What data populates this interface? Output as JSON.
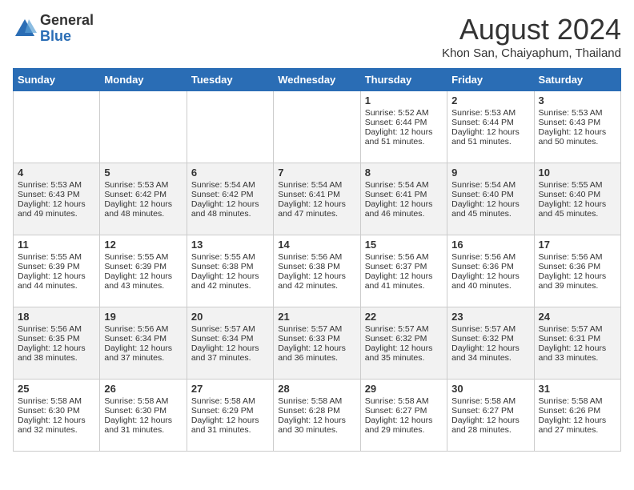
{
  "header": {
    "logo_general": "General",
    "logo_blue": "Blue",
    "month_year": "August 2024",
    "location": "Khon San, Chaiyaphum, Thailand"
  },
  "days_of_week": [
    "Sunday",
    "Monday",
    "Tuesday",
    "Wednesday",
    "Thursday",
    "Friday",
    "Saturday"
  ],
  "weeks": [
    [
      {
        "day": "",
        "content": ""
      },
      {
        "day": "",
        "content": ""
      },
      {
        "day": "",
        "content": ""
      },
      {
        "day": "",
        "content": ""
      },
      {
        "day": "1",
        "content": "Sunrise: 5:52 AM\nSunset: 6:44 PM\nDaylight: 12 hours\nand 51 minutes."
      },
      {
        "day": "2",
        "content": "Sunrise: 5:53 AM\nSunset: 6:44 PM\nDaylight: 12 hours\nand 51 minutes."
      },
      {
        "day": "3",
        "content": "Sunrise: 5:53 AM\nSunset: 6:43 PM\nDaylight: 12 hours\nand 50 minutes."
      }
    ],
    [
      {
        "day": "4",
        "content": "Sunrise: 5:53 AM\nSunset: 6:43 PM\nDaylight: 12 hours\nand 49 minutes."
      },
      {
        "day": "5",
        "content": "Sunrise: 5:53 AM\nSunset: 6:42 PM\nDaylight: 12 hours\nand 48 minutes."
      },
      {
        "day": "6",
        "content": "Sunrise: 5:54 AM\nSunset: 6:42 PM\nDaylight: 12 hours\nand 48 minutes."
      },
      {
        "day": "7",
        "content": "Sunrise: 5:54 AM\nSunset: 6:41 PM\nDaylight: 12 hours\nand 47 minutes."
      },
      {
        "day": "8",
        "content": "Sunrise: 5:54 AM\nSunset: 6:41 PM\nDaylight: 12 hours\nand 46 minutes."
      },
      {
        "day": "9",
        "content": "Sunrise: 5:54 AM\nSunset: 6:40 PM\nDaylight: 12 hours\nand 45 minutes."
      },
      {
        "day": "10",
        "content": "Sunrise: 5:55 AM\nSunset: 6:40 PM\nDaylight: 12 hours\nand 45 minutes."
      }
    ],
    [
      {
        "day": "11",
        "content": "Sunrise: 5:55 AM\nSunset: 6:39 PM\nDaylight: 12 hours\nand 44 minutes."
      },
      {
        "day": "12",
        "content": "Sunrise: 5:55 AM\nSunset: 6:39 PM\nDaylight: 12 hours\nand 43 minutes."
      },
      {
        "day": "13",
        "content": "Sunrise: 5:55 AM\nSunset: 6:38 PM\nDaylight: 12 hours\nand 42 minutes."
      },
      {
        "day": "14",
        "content": "Sunrise: 5:56 AM\nSunset: 6:38 PM\nDaylight: 12 hours\nand 42 minutes."
      },
      {
        "day": "15",
        "content": "Sunrise: 5:56 AM\nSunset: 6:37 PM\nDaylight: 12 hours\nand 41 minutes."
      },
      {
        "day": "16",
        "content": "Sunrise: 5:56 AM\nSunset: 6:36 PM\nDaylight: 12 hours\nand 40 minutes."
      },
      {
        "day": "17",
        "content": "Sunrise: 5:56 AM\nSunset: 6:36 PM\nDaylight: 12 hours\nand 39 minutes."
      }
    ],
    [
      {
        "day": "18",
        "content": "Sunrise: 5:56 AM\nSunset: 6:35 PM\nDaylight: 12 hours\nand 38 minutes."
      },
      {
        "day": "19",
        "content": "Sunrise: 5:56 AM\nSunset: 6:34 PM\nDaylight: 12 hours\nand 37 minutes."
      },
      {
        "day": "20",
        "content": "Sunrise: 5:57 AM\nSunset: 6:34 PM\nDaylight: 12 hours\nand 37 minutes."
      },
      {
        "day": "21",
        "content": "Sunrise: 5:57 AM\nSunset: 6:33 PM\nDaylight: 12 hours\nand 36 minutes."
      },
      {
        "day": "22",
        "content": "Sunrise: 5:57 AM\nSunset: 6:32 PM\nDaylight: 12 hours\nand 35 minutes."
      },
      {
        "day": "23",
        "content": "Sunrise: 5:57 AM\nSunset: 6:32 PM\nDaylight: 12 hours\nand 34 minutes."
      },
      {
        "day": "24",
        "content": "Sunrise: 5:57 AM\nSunset: 6:31 PM\nDaylight: 12 hours\nand 33 minutes."
      }
    ],
    [
      {
        "day": "25",
        "content": "Sunrise: 5:58 AM\nSunset: 6:30 PM\nDaylight: 12 hours\nand 32 minutes."
      },
      {
        "day": "26",
        "content": "Sunrise: 5:58 AM\nSunset: 6:30 PM\nDaylight: 12 hours\nand 31 minutes."
      },
      {
        "day": "27",
        "content": "Sunrise: 5:58 AM\nSunset: 6:29 PM\nDaylight: 12 hours\nand 31 minutes."
      },
      {
        "day": "28",
        "content": "Sunrise: 5:58 AM\nSunset: 6:28 PM\nDaylight: 12 hours\nand 30 minutes."
      },
      {
        "day": "29",
        "content": "Sunrise: 5:58 AM\nSunset: 6:27 PM\nDaylight: 12 hours\nand 29 minutes."
      },
      {
        "day": "30",
        "content": "Sunrise: 5:58 AM\nSunset: 6:27 PM\nDaylight: 12 hours\nand 28 minutes."
      },
      {
        "day": "31",
        "content": "Sunrise: 5:58 AM\nSunset: 6:26 PM\nDaylight: 12 hours\nand 27 minutes."
      }
    ]
  ]
}
